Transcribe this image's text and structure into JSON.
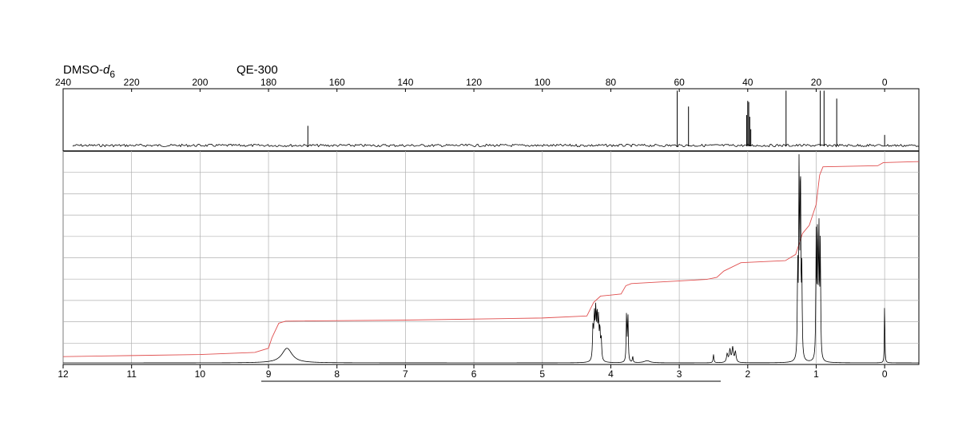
{
  "header": {
    "solvent_prefix": "DMSO-",
    "solvent_italic": "d",
    "solvent_sub": "6",
    "instrument": "QE-300"
  },
  "colors": {
    "spectrum": "#000000",
    "integral": "#e05050",
    "grid": "#b0b0b0",
    "frame": "#000000"
  },
  "chart_data": [
    {
      "type": "line",
      "title": "",
      "xlabel": "",
      "ylabel": "",
      "xlim": [
        240,
        -10
      ],
      "xticks": [
        240,
        220,
        200,
        180,
        160,
        140,
        120,
        100,
        80,
        60,
        40,
        20,
        0
      ],
      "grid": false,
      "peaks": [
        {
          "ppm": 168.5,
          "height": 0.36
        },
        {
          "ppm": 60.6,
          "height": 0.98
        },
        {
          "ppm": 57.3,
          "height": 0.7
        },
        {
          "ppm": 40.3,
          "height": 0.55
        },
        {
          "ppm": 40.0,
          "height": 0.8
        },
        {
          "ppm": 39.7,
          "height": 0.78
        },
        {
          "ppm": 39.4,
          "height": 0.52
        },
        {
          "ppm": 39.1,
          "height": 0.3
        },
        {
          "ppm": 28.8,
          "height": 0.98
        },
        {
          "ppm": 18.8,
          "height": 0.98
        },
        {
          "ppm": 17.7,
          "height": 0.98
        },
        {
          "ppm": 14.0,
          "height": 0.84
        },
        {
          "ppm": 0.0,
          "height": 0.2
        }
      ]
    },
    {
      "type": "line",
      "title": "",
      "xlabel": "",
      "ylabel": "",
      "xlim": [
        12,
        -0.5
      ],
      "xticks": [
        12,
        11,
        10,
        9,
        8,
        7,
        6,
        5,
        4,
        3,
        2,
        1,
        0
      ],
      "grid": true,
      "peaks": [
        {
          "ppm": 8.73,
          "height": 0.07,
          "width": 0.09
        },
        {
          "ppm": 4.26,
          "height": 0.16,
          "width": 0.008
        },
        {
          "ppm": 4.24,
          "height": 0.2,
          "width": 0.008
        },
        {
          "ppm": 4.22,
          "height": 0.22,
          "width": 0.008
        },
        {
          "ppm": 4.2,
          "height": 0.2,
          "width": 0.008
        },
        {
          "ppm": 4.18,
          "height": 0.18,
          "width": 0.008
        },
        {
          "ppm": 4.16,
          "height": 0.14,
          "width": 0.008
        },
        {
          "ppm": 4.14,
          "height": 0.1,
          "width": 0.008
        },
        {
          "ppm": 3.77,
          "height": 0.24,
          "width": 0.006
        },
        {
          "ppm": 3.75,
          "height": 0.23,
          "width": 0.006
        },
        {
          "ppm": 3.68,
          "height": 0.03,
          "width": 0.006
        },
        {
          "ppm": 3.47,
          "height": 0.01,
          "width": 0.05
        },
        {
          "ppm": 2.5,
          "height": 0.04,
          "width": 0.007
        },
        {
          "ppm": 2.3,
          "height": 0.04,
          "width": 0.012
        },
        {
          "ppm": 2.26,
          "height": 0.06,
          "width": 0.012
        },
        {
          "ppm": 2.22,
          "height": 0.07,
          "width": 0.012
        },
        {
          "ppm": 2.18,
          "height": 0.05,
          "width": 0.012
        },
        {
          "ppm": 1.25,
          "height": 0.96,
          "width": 0.006
        },
        {
          "ppm": 1.23,
          "height": 0.93,
          "width": 0.006
        },
        {
          "ppm": 1.27,
          "height": 0.43,
          "width": 0.006
        },
        {
          "ppm": 1.21,
          "height": 0.4,
          "width": 0.006
        },
        {
          "ppm": 1.0,
          "height": 0.58,
          "width": 0.006
        },
        {
          "ppm": 0.98,
          "height": 0.63,
          "width": 0.006
        },
        {
          "ppm": 0.96,
          "height": 0.6,
          "width": 0.006
        },
        {
          "ppm": 0.94,
          "height": 0.56,
          "width": 0.006
        },
        {
          "ppm": 0.0,
          "height": 0.32,
          "width": 0.004
        }
      ],
      "integral_curve": [
        [
          12.0,
          0.03
        ],
        [
          11.0,
          0.035
        ],
        [
          10.0,
          0.04
        ],
        [
          9.2,
          0.05
        ],
        [
          9.0,
          0.07
        ],
        [
          8.95,
          0.12
        ],
        [
          8.85,
          0.19
        ],
        [
          8.75,
          0.2
        ],
        [
          7.0,
          0.205
        ],
        [
          5.0,
          0.215
        ],
        [
          4.35,
          0.225
        ],
        [
          4.25,
          0.29
        ],
        [
          4.15,
          0.32
        ],
        [
          3.85,
          0.33
        ],
        [
          3.78,
          0.37
        ],
        [
          3.7,
          0.38
        ],
        [
          2.6,
          0.4
        ],
        [
          2.45,
          0.41
        ],
        [
          2.35,
          0.44
        ],
        [
          2.1,
          0.48
        ],
        [
          1.45,
          0.49
        ],
        [
          1.3,
          0.52
        ],
        [
          1.2,
          0.62
        ],
        [
          1.1,
          0.66
        ],
        [
          1.0,
          0.76
        ],
        [
          0.95,
          0.9
        ],
        [
          0.9,
          0.94
        ],
        [
          0.1,
          0.945
        ],
        [
          0.02,
          0.96
        ],
        [
          -0.5,
          0.965
        ]
      ]
    }
  ]
}
